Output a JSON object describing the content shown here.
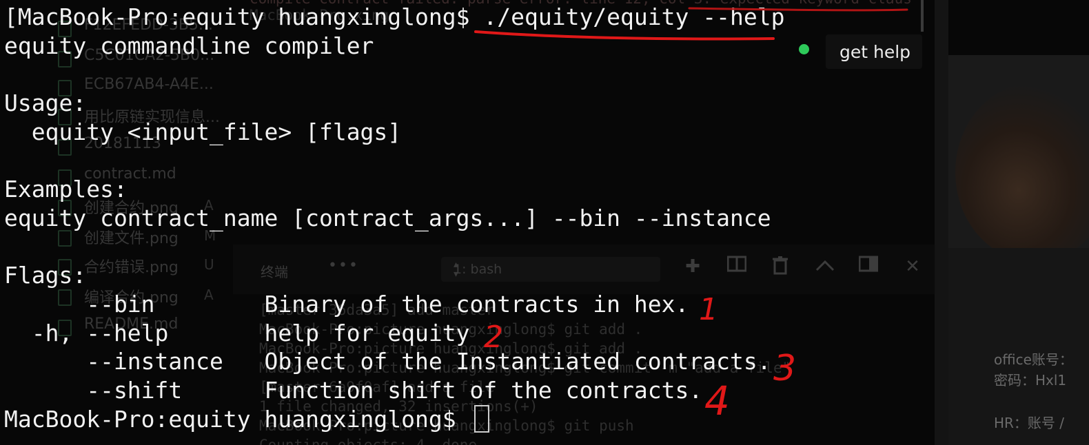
{
  "terminal": {
    "lines": [
      "[MacBook-Pro:equity huangxinglong$ ./equity/equity --help",
      "equity commandline compiler",
      "",
      "Usage:",
      "  equity <input_file> [flags]",
      "",
      "Examples:",
      "equity contract_name [contract_args...] --bin --instance",
      "",
      "Flags:",
      "      --bin        Binary of the contracts in hex.",
      "  -h, --help       help for equity",
      "      --instance   Object of the Instantiated contracts.",
      "      --shift      Function shift of the contracts."
    ],
    "prompt": "MacBook-Pro:equity huangxinglong$ "
  },
  "tooltip": {
    "label": "get help",
    "dot_color": "#2ec95a"
  },
  "annotations": {
    "numbers": [
      "1",
      "2",
      "3",
      "4"
    ],
    "color": "#e01818"
  },
  "background": {
    "top_error_text": "compile contract failed: parse error: line 12, col 3: expected keyword claus",
    "top_error_text2": "MacBook-Pro:xing",
    "explorer_items": [
      {
        "name": "F12EFEDD-3B5...",
        "tag": ""
      },
      {
        "name": "C5C01CA2-5B0...",
        "tag": ""
      },
      {
        "name": "ECB67AB4-A4E...",
        "tag": ""
      },
      {
        "name": "用比原链实现信息...",
        "tag": ""
      },
      {
        "name": "20181113",
        "tag": ""
      },
      {
        "name": "contract.md",
        "tag": ""
      },
      {
        "name": "创建合约.png",
        "tag": "A"
      },
      {
        "name": "创建文件.png",
        "tag": "M"
      },
      {
        "name": "合约错误.png",
        "tag": "U"
      },
      {
        "name": "编译合约.png",
        "tag": "A"
      },
      {
        "name": "README.md",
        "tag": ""
      }
    ],
    "panel": {
      "title": "终端",
      "dots": "•••",
      "shell": "1: bash"
    },
    "bg_terminal_lines": [
      "[master 36da3a5] add master",
      "MacBook-Pro:picture huangxinglong$ git add .",
      "MacBook-Pro:picture huangxinglong$ git add .",
      "MacBook-Pro:picture huangxinglong$ git commit -m \"add a file\"",
      "[master 6a9f0af] add a file",
      " 1 file changed, 32 insertions(+)",
      "MacBook-Pro:picture huangxinglong$ git push",
      "Counting objects: 4, done."
    ],
    "right_pane": {
      "line1": "office账号：",
      "line2": "密码：Hxl1",
      "line3": "HR：账号 /"
    }
  }
}
